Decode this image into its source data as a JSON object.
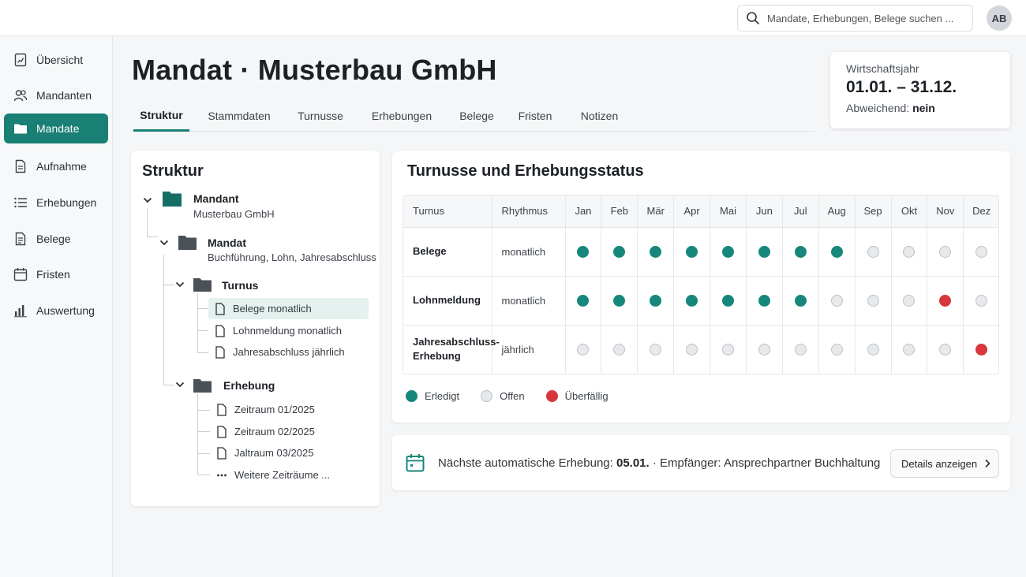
{
  "header": {
    "search_placeholder": "Mandate, Erhebungen, Belege suchen ...",
    "avatar_initials": "AB"
  },
  "sidebar": {
    "items": [
      {
        "label": "Übersicht",
        "icon": "report-icon"
      },
      {
        "label": "Mandanten",
        "icon": "users-icon"
      },
      {
        "label": "Mandate",
        "icon": "folder-icon",
        "active": true
      },
      {
        "label": "Aufnahme",
        "icon": "document-icon"
      },
      {
        "label": "Erhebungen",
        "icon": "list-icon"
      },
      {
        "label": "Belege",
        "icon": "document-icon"
      },
      {
        "label": "Fristen",
        "icon": "calendar-icon"
      },
      {
        "label": "Auswertung",
        "icon": "bar-chart-icon"
      }
    ]
  },
  "page": {
    "title": "Mandat · Musterbau GmbH",
    "tabs": [
      "Struktur",
      "Stammdaten",
      "Turnusse",
      "Erhebungen",
      "Belege",
      "Fristen",
      "Notizen"
    ],
    "active_tab": "Struktur"
  },
  "fiscal_year": {
    "label": "Wirtschaftsjahr",
    "value": "01.01. – 31.12.",
    "deviation_label": "Abweichend:",
    "deviation_value": "nein"
  },
  "structure": {
    "title": "Struktur",
    "mandant": {
      "title": "Mandant",
      "subtitle": "Musterbau GmbH"
    },
    "mandat": {
      "title": "Mandat",
      "subtitle": "Buchführung, Lohn, Jahresabschluss"
    },
    "turnus": {
      "title": "Turnus",
      "items": [
        "Belege monatlich",
        "Lohnmeldung monatlich",
        "Jahresabschluss jährlich"
      ],
      "selected": "Belege monatlich"
    },
    "erhebung": {
      "title": "Erhebung",
      "items": [
        "Zeitraum 01/2025",
        "Zeitraum 02/2025",
        "Jaltraum 03/2025",
        "Weitere Zeiträume ..."
      ]
    }
  },
  "status": {
    "title": "Turnusse und Erhebungsstatus",
    "col_turnus": "Turnus",
    "col_rhythmus": "Rhythmus",
    "months": [
      "Jan",
      "Feb",
      "Mär",
      "Apr",
      "Mai",
      "Jun",
      "Jul",
      "Aug",
      "Sep",
      "Okt",
      "Nov",
      "Dez"
    ],
    "rows": [
      {
        "name": "Belege",
        "rhythm": "monatlich",
        "states": [
          "done",
          "done",
          "done",
          "done",
          "done",
          "done",
          "done",
          "done",
          "open",
          "open",
          "open",
          "open"
        ]
      },
      {
        "name": "Lohnmeldung",
        "rhythm": "monatlich",
        "states": [
          "done",
          "done",
          "done",
          "done",
          "done",
          "done",
          "done",
          "open",
          "open",
          "open",
          "late",
          "open"
        ]
      },
      {
        "name_lines": [
          "Jahresabschluss-",
          "Erhebung"
        ],
        "rhythm": "jährlich",
        "states": [
          "open",
          "open",
          "open",
          "open",
          "open",
          "open",
          "open",
          "open",
          "open",
          "open",
          "open",
          "late"
        ]
      }
    ],
    "legend": {
      "done": "Erledigt",
      "open": "Offen",
      "late": "Überfällig"
    },
    "colors": {
      "done": "#16877a",
      "open": "#e7e9eb",
      "late": "#d7373b",
      "accent": "#1a7f74"
    }
  },
  "next_run": {
    "label": "Nächste automatische Erhebung:",
    "date": "05.01.",
    "separator": "·",
    "recipient_label": "Empfänger:",
    "recipient": "Ansprechpartner Buchhaltung",
    "button": "Details anzeigen"
  }
}
